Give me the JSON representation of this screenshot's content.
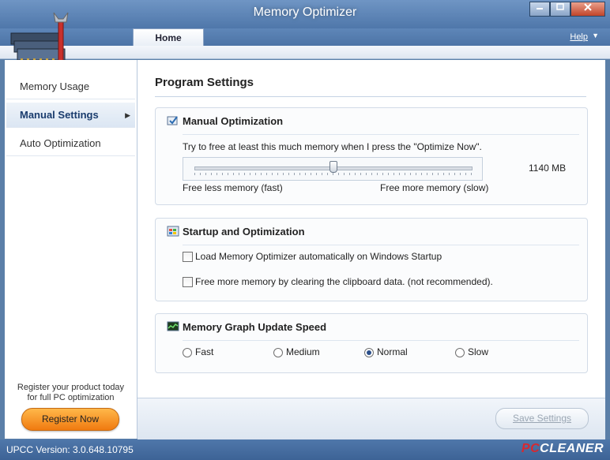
{
  "window": {
    "title": "Memory Optimizer",
    "controls": [
      "minimize",
      "maximize",
      "close"
    ]
  },
  "header": {
    "tab_home": "Home",
    "help_label": "Help",
    "help_arrow": "▼"
  },
  "sidebar": {
    "items": [
      {
        "label": "Memory Usage",
        "active": false
      },
      {
        "label": "Manual Settings",
        "active": true
      },
      {
        "label": "Auto Optimization",
        "active": false
      }
    ],
    "register_text_1": "Register your product today",
    "register_text_2": "for full PC optimization",
    "register_button": "Register Now"
  },
  "main": {
    "page_title": "Program Settings",
    "manual": {
      "title": "Manual Optimization",
      "description": "Try to free at least this much memory when I press the \"Optimize Now\".",
      "slider_value_fraction": 0.5,
      "value_text": "1140 MB",
      "min_label": "Free less memory (fast)",
      "max_label": "Free more memory (slow)"
    },
    "startup": {
      "title": "Startup and Optimization",
      "options": [
        {
          "label": "Load Memory Optimizer automatically on Windows Startup",
          "checked": false
        },
        {
          "label": "Free more memory by clearing the clipboard data. (not recommended).",
          "checked": false
        }
      ]
    },
    "graph": {
      "title": "Memory Graph Update Speed",
      "options": [
        {
          "label": "Fast",
          "selected": false
        },
        {
          "label": "Medium",
          "selected": false
        },
        {
          "label": "Normal",
          "selected": true
        },
        {
          "label": "Slow",
          "selected": false
        }
      ]
    },
    "save_button": "Save Settings"
  },
  "status": {
    "version": "UPCC Version: 3.0.648.10795",
    "brand_pc": "PC",
    "brand_name": "CLEANER"
  },
  "colors": {
    "accent": "#4f77aa",
    "register": "#f07a10",
    "brand_red": "#d9282f"
  }
}
